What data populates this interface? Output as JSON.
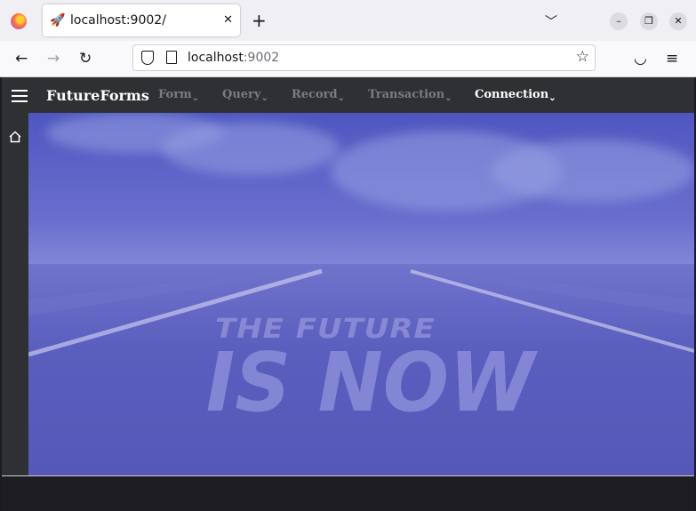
{
  "browser": {
    "tab": {
      "title": "localhost:9002/",
      "favicon": "rocket-icon"
    },
    "url": {
      "host": "localhost",
      "port": ":9002"
    }
  },
  "app": {
    "brand": "FutureForms",
    "menu": [
      {
        "label": "Form"
      },
      {
        "label": "Query"
      },
      {
        "label": "Record"
      },
      {
        "label": "Transaction"
      },
      {
        "label": "Connection"
      }
    ],
    "hero": {
      "line1": "THE FUTURE",
      "line2": "IS NOW"
    }
  },
  "colors": {
    "accent": "#5a5fc4",
    "appbar": "#2f3034"
  }
}
